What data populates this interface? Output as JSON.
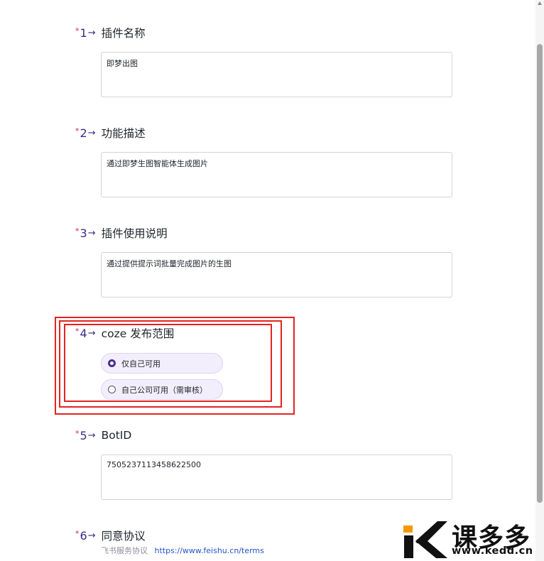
{
  "questions": [
    {
      "star": "*",
      "num": "1",
      "arrow": "→",
      "title": "插件名称",
      "value": "即梦出图"
    },
    {
      "star": "*",
      "num": "2",
      "arrow": "→",
      "title": "功能描述",
      "value": "通过即梦生图智能体生成图片"
    },
    {
      "star": "*",
      "num": "3",
      "arrow": "→",
      "title": "插件使用说明",
      "value": "通过提供提示词批量完成图片的生图"
    },
    {
      "star": "*",
      "num": "4",
      "arrow": "→",
      "title": "coze 发布范围",
      "options": [
        {
          "label": "仅自己可用",
          "selected": true
        },
        {
          "label": "自己公司可用（需审核）",
          "selected": false
        }
      ]
    },
    {
      "star": "*",
      "num": "5",
      "arrow": "→",
      "title": "BotID",
      "value": "7505237113458622500"
    },
    {
      "star": "*",
      "num": "6",
      "arrow": "→",
      "title": "同意协议"
    }
  ],
  "agreement": {
    "service_label": "飞书服务协议",
    "service_link": "https://www.feishu.cn/terms"
  },
  "watermark": {
    "brand": "课多多",
    "url": "www.kedd.cn",
    "accent_color": "#f39800"
  },
  "colors": {
    "highlight": "#e3241e",
    "number": "#3d2a8c",
    "radio_selected": "#4b2d8f",
    "radio_bg": "#f3eefc"
  }
}
